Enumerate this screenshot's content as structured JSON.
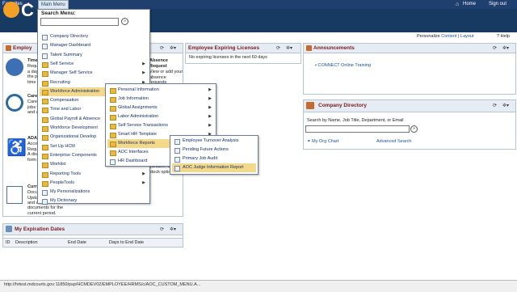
{
  "topbar": {
    "favorites": "Favorites",
    "main_menu": "Main Menu",
    "home": "Home",
    "sign_out": "Sign out"
  },
  "header": {
    "personalize": "Personalize",
    "content": "Content",
    "layout": "Layout",
    "help": "Help"
  },
  "main_menu": {
    "search_label": "Search Menu:",
    "search_value": "",
    "items": [
      {
        "label": "Company Directory",
        "type": "page",
        "arrow": false
      },
      {
        "label": "Manager Dashboard",
        "type": "page",
        "arrow": false
      },
      {
        "label": "Talent Summary",
        "type": "page",
        "arrow": false
      },
      {
        "label": "Self Service",
        "type": "folder",
        "arrow": true
      },
      {
        "label": "Manager Self Service",
        "type": "folder",
        "arrow": true
      },
      {
        "label": "Recruiting",
        "type": "folder",
        "arrow": true
      },
      {
        "label": "Workforce Administration",
        "type": "folder",
        "arrow": true,
        "highlight": true
      },
      {
        "label": "Compensation",
        "type": "folder",
        "arrow": true
      },
      {
        "label": "Time and Labor",
        "type": "folder",
        "arrow": true
      },
      {
        "label": "Global Payroll & Absence",
        "type": "folder",
        "arrow": true
      },
      {
        "label": "Workforce Development",
        "type": "folder",
        "arrow": true
      },
      {
        "label": "Organizational Develop",
        "type": "folder",
        "arrow": true
      },
      {
        "label": "Set Up HCM",
        "type": "folder",
        "arrow": true
      },
      {
        "label": "Enterprise Components",
        "type": "folder",
        "arrow": true
      },
      {
        "label": "Worklist",
        "type": "folder",
        "arrow": true
      },
      {
        "label": "Reporting Tools",
        "type": "folder",
        "arrow": true
      },
      {
        "label": "PeopleTools",
        "type": "folder",
        "arrow": true
      },
      {
        "label": "My Personalizations",
        "type": "page",
        "arrow": false
      },
      {
        "label": "My Dictionary",
        "type": "page",
        "arrow": false
      }
    ]
  },
  "sub_menu": {
    "items": [
      {
        "label": "Personal Information",
        "type": "folder",
        "arrow": true
      },
      {
        "label": "Job Information",
        "type": "folder",
        "arrow": true
      },
      {
        "label": "Global Assignments",
        "type": "folder",
        "arrow": true
      },
      {
        "label": "Labor Administration",
        "type": "folder",
        "arrow": true
      },
      {
        "label": "Self Service Transactions",
        "type": "folder",
        "arrow": true
      },
      {
        "label": "Smart HR Template",
        "type": "folder",
        "arrow": true
      },
      {
        "label": "Workforce Reports",
        "type": "folder",
        "arrow": true,
        "highlight": true
      },
      {
        "label": "AOC Interfaces",
        "type": "folder",
        "arrow": true
      },
      {
        "label": "HR Dashboard",
        "type": "page",
        "arrow": false
      }
    ]
  },
  "sub_sub_menu": {
    "items": [
      {
        "label": "Employee Turnover Analysis",
        "type": "page"
      },
      {
        "label": "Pending Future Actions",
        "type": "page"
      },
      {
        "label": "Primary Job Audit",
        "type": "page"
      },
      {
        "label": "AOC Judge Information Report",
        "type": "page",
        "highlight": true
      }
    ]
  },
  "left_pagelet": {
    "title": "Employ",
    "rows": [
      {
        "title": "Time",
        "lines": [
          "Reques",
          "a day",
          "the pa",
          "time p"
        ]
      },
      {
        "title": "Caree",
        "lines": [
          "Caree",
          "jobs w",
          "and a"
        ]
      },
      {
        "title": "ADA",
        "lines": [
          "Acco",
          "Requ",
          "A dis",
          "form"
        ]
      },
      {
        "title": "Curri",
        "lines": [
          "Docu",
          "Upda",
          "and a"
        ]
      }
    ],
    "absence_request": "Absence Request",
    "absence_lines": [
      "View or add your",
      "absence",
      "requests"
    ],
    "right_fragment": "variable, and",
    "right_fragment2": "stock option",
    "curr_lines": [
      "documents for the",
      "current period."
    ]
  },
  "expiring": {
    "title": "Employee Expiring Licenses",
    "text": "No expiring licenses in the next 60 days"
  },
  "announcements": {
    "title": "Announcements",
    "items": [
      "CONNECT Online Training"
    ]
  },
  "company_directory": {
    "title": "Company Directory",
    "search_label": "Search by Name, Job Title, Department, or Email",
    "search_value": "",
    "my_org_chart": "My Org Chart",
    "advanced_search": "Advanced Search"
  },
  "expiration_dates": {
    "title": "My Expiration Dates",
    "columns": [
      "ID",
      "Description",
      "End Date",
      "Days to End Date"
    ]
  },
  "status_bar": {
    "url": "http://hrtest.mdcourts.gov:11850/psp/HCMDEV02/EMPLOYEE/HRMS/c/AOC_CUSTOM_MENU.A..."
  },
  "colors": {
    "topbar": "#1f3f6e",
    "header": "#173a63",
    "menu_highlight": "#f5d98a",
    "pagelet_title": "#7a1b1b"
  }
}
